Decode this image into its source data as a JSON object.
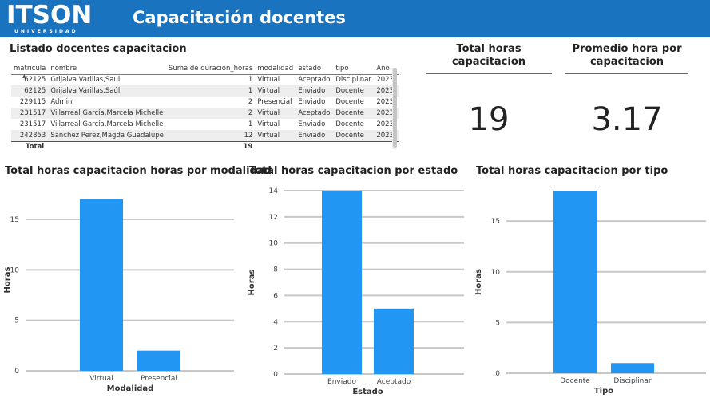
{
  "header": {
    "logo_main": "ITSON",
    "logo_sub": "UNIVERSIDAD",
    "title": "Capacitación docentes",
    "color": "#1a73bf"
  },
  "table": {
    "title": "Listado docentes capacitacion",
    "columns": [
      "matricula",
      "nombre",
      "Suma de duracion_horas",
      "modalidad",
      "estado",
      "tipo",
      "Año"
    ],
    "rows": [
      [
        "62125",
        "Grijalva Varillas,Saul",
        "1",
        "Virtual",
        "Aceptado",
        "Disciplinar",
        "2023"
      ],
      [
        "62125",
        "Grijalva Varillas,Saúl",
        "1",
        "Virtual",
        "Enviado",
        "Docente",
        "2023"
      ],
      [
        "229115",
        "Admin",
        "2",
        "Presencial",
        "Enviado",
        "Docente",
        "2023"
      ],
      [
        "231517",
        "Villarreal García,Marcela Michelle",
        "2",
        "Virtual",
        "Aceptado",
        "Docente",
        "2023"
      ],
      [
        "231517",
        "Villarreal García,Marcela Michelle",
        "1",
        "Virtual",
        "Enviado",
        "Docente",
        "2023"
      ],
      [
        "242853",
        "Sánchez Perez,Magda Guadalupe",
        "12",
        "Virtual",
        "Enviado",
        "Docente",
        "2023"
      ]
    ],
    "total_label": "Total",
    "total_value": "19"
  },
  "kpis": {
    "total_label": "Total horas capacitacion",
    "total_value": "19",
    "avg_label": "Promedio hora por capacitacion",
    "avg_value": "3.17"
  },
  "chart_data": [
    {
      "type": "bar",
      "title": "Total horas capacitacion horas por modalidad",
      "categories": [
        "Virtual",
        "Presencial"
      ],
      "values": [
        17,
        2
      ],
      "xlabel": "Modalidad",
      "ylabel": "Horas",
      "ylim": [
        0,
        18
      ],
      "yticks": [
        0,
        5,
        10,
        15
      ],
      "grid": true,
      "bar_color": "#2196f3"
    },
    {
      "type": "bar",
      "title": "Total horas capacitacion por estado",
      "categories": [
        "Enviado",
        "Aceptado"
      ],
      "values": [
        14,
        5
      ],
      "xlabel": "Estado",
      "ylabel": "Horas",
      "ylim": [
        0,
        14
      ],
      "yticks": [
        0,
        2,
        4,
        6,
        8,
        10,
        12,
        14
      ],
      "grid": true,
      "bar_color": "#2196f3"
    },
    {
      "type": "bar",
      "title": "Total horas capacitacion por tipo",
      "categories": [
        "Docente",
        "Disciplinar"
      ],
      "values": [
        18,
        1
      ],
      "xlabel": "Tipo",
      "ylabel": "Horas",
      "ylim": [
        0,
        18
      ],
      "yticks": [
        0,
        5,
        10,
        15
      ],
      "grid": true,
      "bar_color": "#2196f3"
    }
  ]
}
